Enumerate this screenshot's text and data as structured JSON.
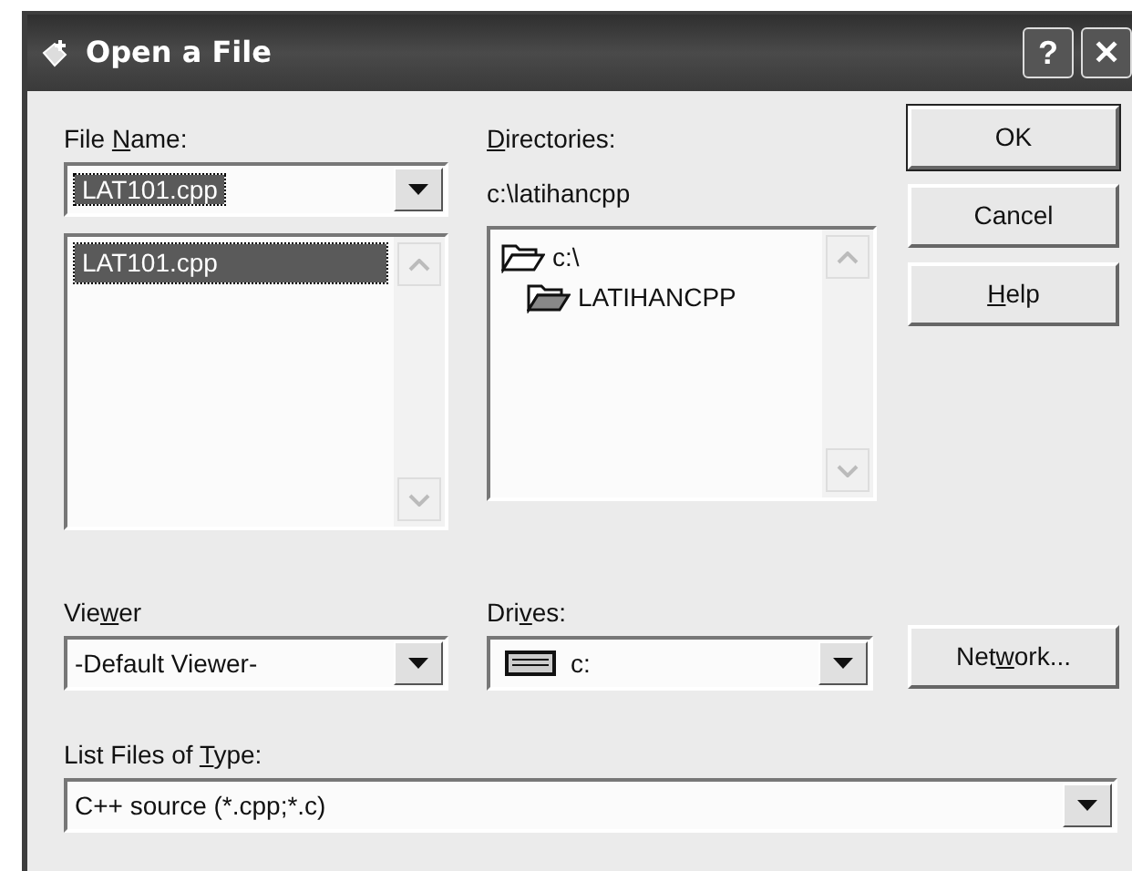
{
  "window": {
    "title": "Open a File",
    "title_buttons": [
      "?",
      "✕"
    ]
  },
  "file_name": {
    "label": [
      {
        "text": "File ",
        "underlined": false
      },
      {
        "text": "N",
        "underlined": true
      },
      {
        "text": "ame:",
        "underlined": false
      }
    ],
    "value": "LAT101.cpp"
  },
  "files": [
    {
      "text": "LAT101.cpp",
      "selected": true
    }
  ],
  "directories": {
    "label": [
      {
        "text": "D",
        "underlined": true
      },
      {
        "text": "irectories:",
        "underlined": false
      }
    ],
    "path": "c:\\latihancpp",
    "tree": [
      {
        "text": "c:\\",
        "children": [
          {
            "text": "LATIHANCPP"
          }
        ]
      }
    ]
  },
  "buttons": [
    {
      "text": [
        {
          "text": "OK",
          "underlined": false
        }
      ],
      "default": true
    },
    {
      "text": [
        {
          "text": "Cancel",
          "underlined": false
        }
      ],
      "default": false
    },
    {
      "text": [
        {
          "text": "H",
          "underlined": true
        },
        {
          "text": "elp",
          "underlined": false
        }
      ],
      "default": false
    }
  ],
  "viewer": {
    "label": [
      {
        "text": "Vie",
        "underlined": false
      },
      {
        "text": "w",
        "underlined": true
      },
      {
        "text": "er",
        "underlined": false
      }
    ],
    "value": "-Default Viewer-"
  },
  "drives": {
    "label": [
      {
        "text": "Dri",
        "underlined": false
      },
      {
        "text": "v",
        "underlined": true
      },
      {
        "text": "es:",
        "underlined": false
      }
    ],
    "value": "c:"
  },
  "network_button": {
    "text": [
      {
        "text": "Net",
        "underlined": false
      },
      {
        "text": "w",
        "underlined": true
      },
      {
        "text": "ork...",
        "underlined": false
      }
    ]
  },
  "file_type": {
    "label": [
      {
        "text": "List Files of ",
        "underlined": false
      },
      {
        "text": "T",
        "underlined": true
      },
      {
        "text": "ype:",
        "underlined": false
      }
    ],
    "value": "C++ source (*.cpp;*.c)"
  }
}
